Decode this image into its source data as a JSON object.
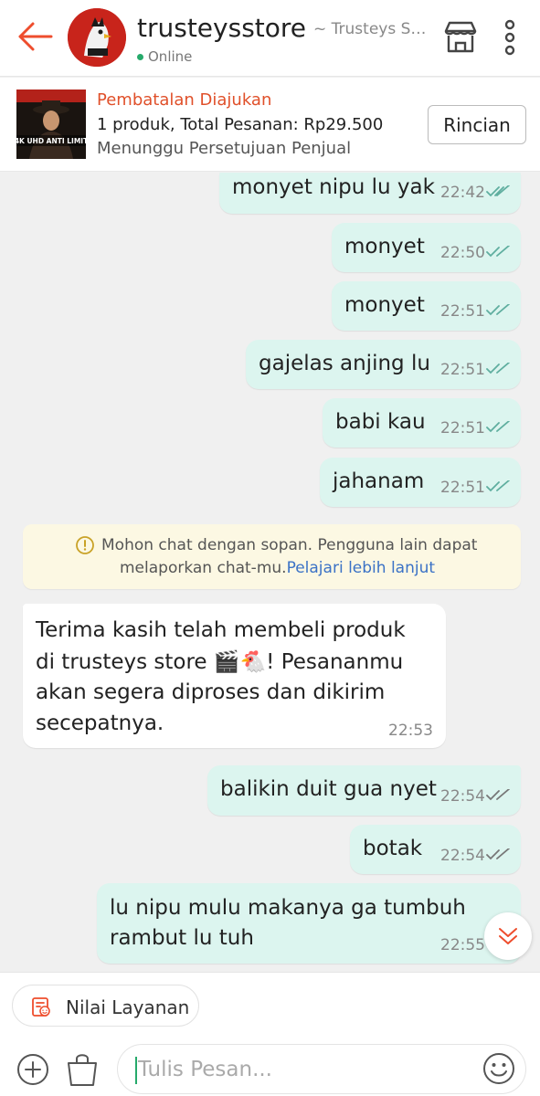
{
  "header": {
    "store_name": "trusteysstore",
    "store_subtitle": "~ Trusteys St...",
    "status": "Online",
    "icons": {
      "back": "back-arrow-icon",
      "shop": "shop-icon",
      "more": "more-vertical-icon"
    }
  },
  "order": {
    "status": "Pembatalan Diajukan",
    "summary": "1 produk, Total Pesanan: Rp29.500",
    "waiting": "Menunggu Persetujuan Penjual",
    "details_button": "Rincian",
    "thumb_caption": "4K UHD ANTI LIMIT"
  },
  "messages": [
    {
      "text": "monyet nipu lu yak",
      "time": "22:42",
      "direction": "out"
    },
    {
      "text": "monyet",
      "time": "22:50",
      "direction": "out"
    },
    {
      "text": "monyet",
      "time": "22:51",
      "direction": "out"
    },
    {
      "text": "gajelas anjing lu",
      "time": "22:51",
      "direction": "out"
    },
    {
      "text": "babi kau",
      "time": "22:51",
      "direction": "out"
    },
    {
      "text": "jahanam",
      "time": "22:51",
      "direction": "out"
    },
    {
      "text": "balikin duit gua nyet",
      "time": "22:54",
      "direction": "out"
    },
    {
      "text": "botak",
      "time": "22:54",
      "direction": "out"
    },
    {
      "text_line1": "lu nipu mulu makanya ga tumbuh",
      "text_line2": "rambut lu tuh",
      "time": "22:55",
      "direction": "out"
    }
  ],
  "notice": {
    "line1": "Mohon chat dengan sopan. Pengguna lain dapat",
    "line2": "melaporkan chat-mu.",
    "link": "Pelajari lebih lanjut"
  },
  "incoming": {
    "line1": "Terima kasih telah membeli produk",
    "line2": "di trusteys store 🎬🐔! Pesananmu",
    "line3": "akan segera diproses dan dikirim",
    "line4": "secepatnya.",
    "time": "22:53"
  },
  "bottom": {
    "rate_label": "Nilai Layanan",
    "input_placeholder": "Tulis Pesan...",
    "icons": {
      "add": "plus-circle-icon",
      "bag": "shopping-bag-icon",
      "emoji": "emoji-icon",
      "rate": "rating-icon"
    }
  },
  "colors": {
    "accent": "#ee4d2d",
    "bubble_out": "#dcf5ef",
    "online": "#26aa6b",
    "link": "#3b72c6"
  }
}
